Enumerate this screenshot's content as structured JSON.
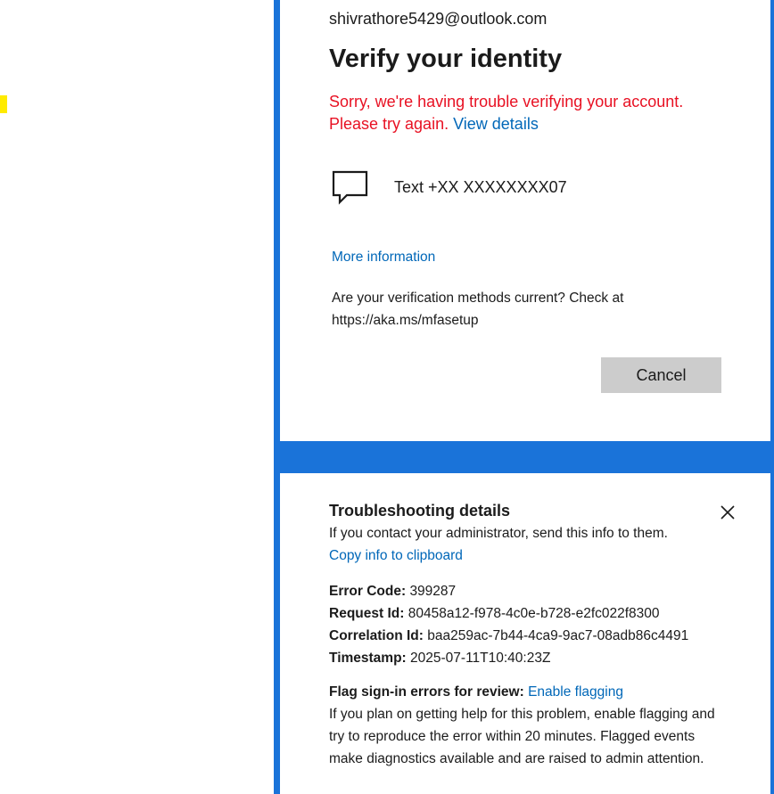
{
  "account_email": "shivrathore5429@outlook.com",
  "title": "Verify your identity",
  "error": {
    "message": "Sorry, we're having trouble verifying your account. Please try again.",
    "view_details_link": "View details"
  },
  "method": {
    "icon": "chat-bubble-icon",
    "label": "Text +XX XXXXXXXX07"
  },
  "more_information_link": "More information",
  "verification_note": "Are your verification methods current? Check at https://aka.ms/mfasetup",
  "cancel_button": "Cancel",
  "troubleshooting": {
    "title": "Troubleshooting details",
    "subtitle": "If you contact your administrator, send this info to them.",
    "copy_link": "Copy info to clipboard",
    "error_code_label": "Error Code:",
    "error_code": "399287",
    "request_id_label": "Request Id:",
    "request_id": "80458a12-f978-4c0e-b728-e2fc022f8300",
    "correlation_id_label": "Correlation Id:",
    "correlation_id": "baa259ac-7b44-4ca9-9ac7-08adb86c4491",
    "timestamp_label": "Timestamp:",
    "timestamp": "2025-07-11T10:40:23Z",
    "flag_label": "Flag sign-in errors for review:",
    "flag_link": "Enable flagging",
    "flag_description": "If you plan on getting help for this problem, enable flagging and try to reproduce the error within 20 minutes. Flagged events make diagnostics available and are raised to admin attention."
  },
  "colors": {
    "frame_blue": "#1a73d9",
    "error_red": "#e81123",
    "link_blue": "#0067b8",
    "button_gray": "#cccccc",
    "highlight_yellow": "#ffeb00"
  }
}
